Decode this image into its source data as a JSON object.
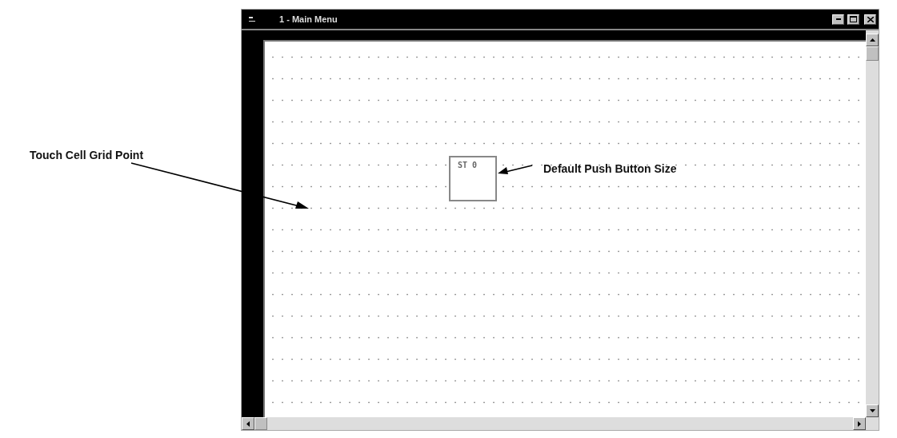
{
  "window": {
    "title": "1 - Main Menu"
  },
  "canvas": {
    "push_button": {
      "label": "ST 0"
    }
  },
  "callouts": [
    {
      "text": "Touch Cell Grid Point",
      "kind": "long"
    },
    {
      "text": "Default Push Button Size",
      "kind": "short"
    }
  ]
}
